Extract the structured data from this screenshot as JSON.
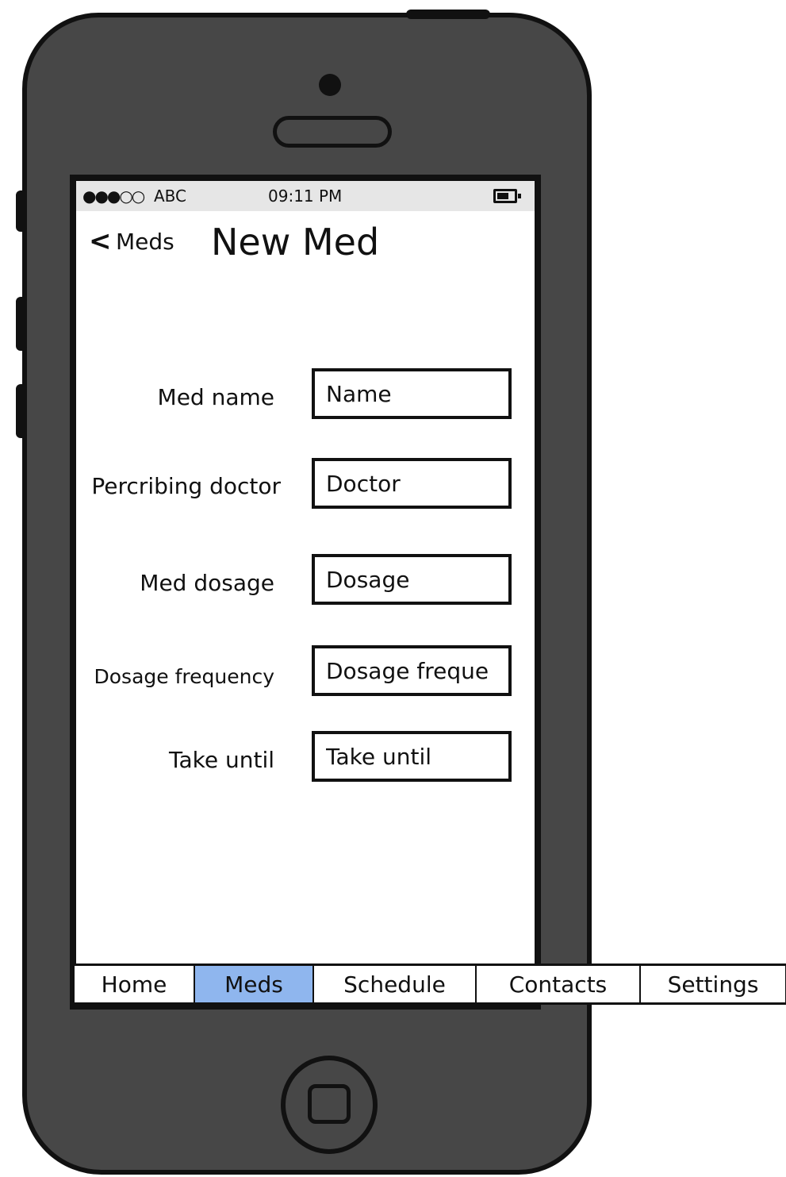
{
  "status_bar": {
    "signal": "●●●○○",
    "carrier": "ABC",
    "time": "09:11 PM"
  },
  "nav": {
    "back_label": "Meds",
    "title": "New Med"
  },
  "form": {
    "fields": [
      {
        "label": "Med name",
        "placeholder": "Name"
      },
      {
        "label": "Percribing doctor",
        "placeholder": "Doctor"
      },
      {
        "label": "Med dosage",
        "placeholder": "Dosage"
      },
      {
        "label": "Dosage frequency",
        "placeholder": "Dosage freque"
      },
      {
        "label": "Take until",
        "placeholder": "Take until"
      }
    ]
  },
  "tabs": [
    {
      "label": "Home"
    },
    {
      "label": "Meds",
      "active": true
    },
    {
      "label": "Schedule"
    },
    {
      "label": "Contacts"
    },
    {
      "label": "Settings"
    }
  ],
  "colors": {
    "phone_body": "#474747",
    "active_tab": "#8fb6ee",
    "status_bar": "#e6e6e6"
  }
}
